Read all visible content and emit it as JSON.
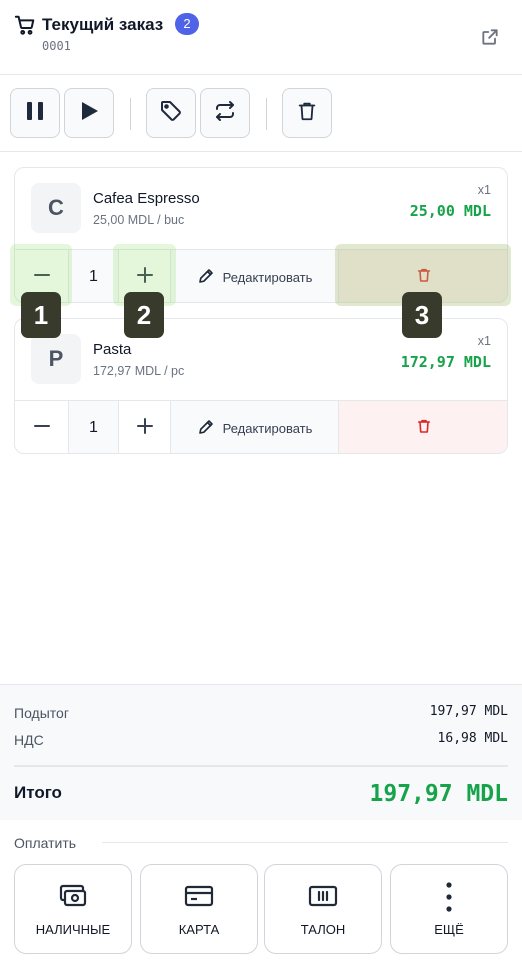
{
  "header": {
    "title": "Текущий заказ",
    "item_count": "2",
    "order_number": "0001"
  },
  "toolbar": {
    "buttons": [
      "pause",
      "play",
      "discount-tag",
      "transfer",
      "delete-order"
    ]
  },
  "items": [
    {
      "initial": "C",
      "name": "Cafea Espresso",
      "unit_price": "25,00 MDL / buc",
      "qty_tag": "x1",
      "total": "25,00 MDL",
      "quantity": "1",
      "edit_label": "Редактировать"
    },
    {
      "initial": "P",
      "name": "Pasta",
      "unit_price": "172,97 MDL / pc",
      "qty_tag": "x1",
      "total": "172,97 MDL",
      "quantity": "1",
      "edit_label": "Редактировать"
    }
  ],
  "markers": [
    "1",
    "2",
    "3"
  ],
  "totals": {
    "subtotal_label": "Подытог",
    "subtotal_value": "197,97 MDL",
    "vat_label": "НДС",
    "vat_value": "16,98 MDL",
    "grand_label": "Итого",
    "grand_value": "197,97 MDL"
  },
  "payment": {
    "title": "Оплатить",
    "methods": [
      {
        "label": "НАЛИЧНЫЕ",
        "icon": "cash-icon"
      },
      {
        "label": "КАРТА",
        "icon": "card-icon"
      },
      {
        "label": "ТАЛОН",
        "icon": "voucher-icon"
      },
      {
        "label": "ЕЩЁ",
        "icon": "more-vertical-icon"
      }
    ]
  },
  "colors": {
    "accent": "#4f63e8",
    "price_green": "#16a34a",
    "delete_red": "#dc2626"
  }
}
